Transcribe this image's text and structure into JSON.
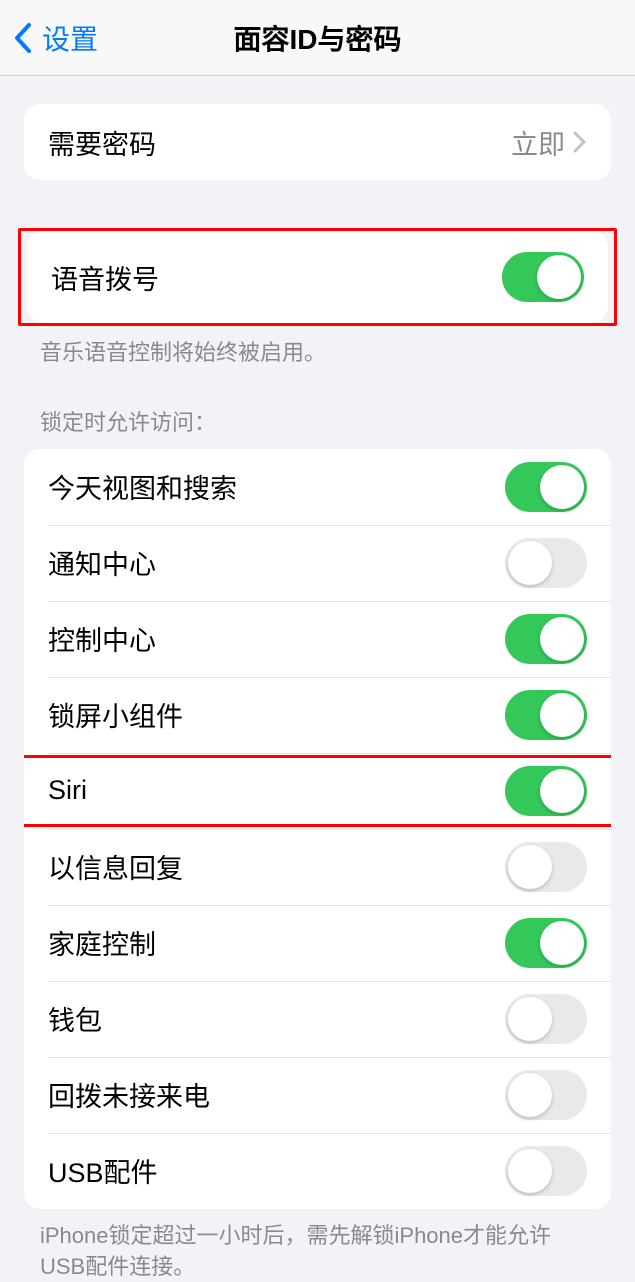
{
  "nav": {
    "back_label": "设置",
    "title": "面容ID与密码"
  },
  "passcode_group": {
    "require_label": "需要密码",
    "require_value": "立即"
  },
  "voice_dial": {
    "label": "语音拨号",
    "on": true,
    "footer": "音乐语音控制将始终被启用。"
  },
  "lock_access": {
    "header": "锁定时允许访问：",
    "items": [
      {
        "label": "今天视图和搜索",
        "on": true
      },
      {
        "label": "通知中心",
        "on": false
      },
      {
        "label": "控制中心",
        "on": true
      },
      {
        "label": "锁屏小组件",
        "on": true
      },
      {
        "label": "Siri",
        "on": true
      },
      {
        "label": "以信息回复",
        "on": false
      },
      {
        "label": "家庭控制",
        "on": true
      },
      {
        "label": "钱包",
        "on": false
      },
      {
        "label": "回拨未接来电",
        "on": false
      },
      {
        "label": "USB配件",
        "on": false
      }
    ],
    "footer": "iPhone锁定超过一小时后，需先解锁iPhone才能允许USB配件连接。"
  }
}
